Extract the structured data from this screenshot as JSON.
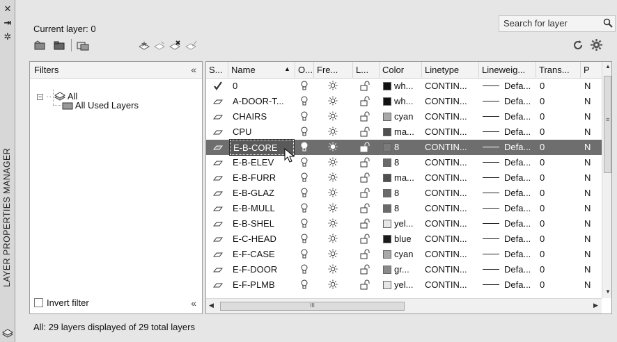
{
  "app": {
    "vertical_title": "LAYER PROPERTIES MANAGER",
    "current_layer": "Current layer: 0",
    "search_placeholder": "Search for layer",
    "status": "All: 29 layers displayed of 29 total layers"
  },
  "filters": {
    "header": "Filters",
    "tree": [
      {
        "label": "All"
      },
      {
        "label": "All Used Layers"
      }
    ],
    "invert_label": "Invert filter"
  },
  "columns": [
    "S...",
    "Name",
    "O...",
    "Fre...",
    "L...",
    "Color",
    "Linetype",
    "Lineweig...",
    "Trans...",
    "P"
  ],
  "layers": [
    {
      "name": "0",
      "color_label": "wh...",
      "swatch": "#111111",
      "linetype": "CONTIN...",
      "lineweight": "Defa...",
      "trans": "0",
      "plot": "N",
      "current": true
    },
    {
      "name": "A-DOOR-T...",
      "color_label": "wh...",
      "swatch": "#111111",
      "linetype": "CONTIN...",
      "lineweight": "Defa...",
      "trans": "0",
      "plot": "N"
    },
    {
      "name": "CHAIRS",
      "color_label": "cyan",
      "swatch": "#a8a8a8",
      "linetype": "CONTIN...",
      "lineweight": "Defa...",
      "trans": "0",
      "plot": "N"
    },
    {
      "name": "CPU",
      "color_label": "ma...",
      "swatch": "#505050",
      "linetype": "CONTIN...",
      "lineweight": "Defa...",
      "trans": "0",
      "plot": "N"
    },
    {
      "name": "E-B-CORE",
      "color_label": "8",
      "swatch": "#7a7a7a",
      "linetype": "CONTIN...",
      "lineweight": "Defa...",
      "trans": "0",
      "plot": "N",
      "selected": true
    },
    {
      "name": "E-B-ELEV",
      "color_label": "8",
      "swatch": "#6a6a6a",
      "linetype": "CONTIN...",
      "lineweight": "Defa...",
      "trans": "0",
      "plot": "N"
    },
    {
      "name": "E-B-FURR",
      "color_label": "ma...",
      "swatch": "#505050",
      "linetype": "CONTIN...",
      "lineweight": "Defa...",
      "trans": "0",
      "plot": "N"
    },
    {
      "name": "E-B-GLAZ",
      "color_label": "8",
      "swatch": "#6a6a6a",
      "linetype": "CONTIN...",
      "lineweight": "Defa...",
      "trans": "0",
      "plot": "N"
    },
    {
      "name": "E-B-MULL",
      "color_label": "8",
      "swatch": "#6a6a6a",
      "linetype": "CONTIN...",
      "lineweight": "Defa...",
      "trans": "0",
      "plot": "N"
    },
    {
      "name": "E-B-SHEL",
      "color_label": "yel...",
      "swatch": "#e6e6e6",
      "linetype": "CONTIN...",
      "lineweight": "Defa...",
      "trans": "0",
      "plot": "N"
    },
    {
      "name": "E-C-HEAD",
      "color_label": "blue",
      "swatch": "#1a1a1a",
      "linetype": "CONTIN...",
      "lineweight": "Defa...",
      "trans": "0",
      "plot": "N"
    },
    {
      "name": "E-F-CASE",
      "color_label": "cyan",
      "swatch": "#a8a8a8",
      "linetype": "CONTIN...",
      "lineweight": "Defa...",
      "trans": "0",
      "plot": "N"
    },
    {
      "name": "E-F-DOOR",
      "color_label": "gr...",
      "swatch": "#8a8a8a",
      "linetype": "CONTIN...",
      "lineweight": "Defa...",
      "trans": "0",
      "plot": "N"
    },
    {
      "name": "E-F-PLMB",
      "color_label": "yel...",
      "swatch": "#e6e6e6",
      "linetype": "CONTIN...",
      "lineweight": "Defa...",
      "trans": "0",
      "plot": "N"
    }
  ],
  "scrollbar_h_glyph": "III"
}
